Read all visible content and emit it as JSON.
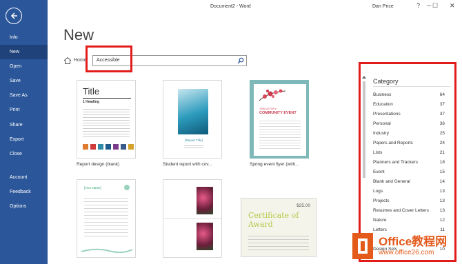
{
  "titlebar": {
    "doc_title": "Document2 - Word",
    "user": "Dan Price",
    "help": "?",
    "minimize": "─",
    "restore": "☐",
    "close": "✕"
  },
  "sidebar": {
    "items": [
      {
        "label": "Info"
      },
      {
        "label": "New"
      },
      {
        "label": "Open"
      },
      {
        "label": "Save"
      },
      {
        "label": "Save As"
      },
      {
        "label": "Print"
      },
      {
        "label": "Share"
      },
      {
        "label": "Export"
      },
      {
        "label": "Close"
      },
      {
        "label": "Account"
      },
      {
        "label": "Feedback"
      },
      {
        "label": "Options"
      }
    ]
  },
  "main": {
    "title": "New",
    "home_label": "Home",
    "search_value": "Accessible"
  },
  "templates": [
    {
      "label": "Report design (blank)",
      "thumb_title": "Title",
      "thumb_heading": "1   Heading"
    },
    {
      "label": "Student report with cov...",
      "thumb_title": "[Report Title]"
    },
    {
      "label": "Spring event flyer (with...",
      "thumb_title": "COMMUNITY EVENT",
      "thumb_sub": "JOIN US FOR A"
    },
    {
      "label": "",
      "thumb_title": "[Your Name]"
    },
    {
      "label": ""
    },
    {
      "label": "",
      "thumb_price": "$25.00",
      "thumb_title": "Certificate of Award"
    }
  ],
  "category": {
    "title": "Category",
    "items": [
      {
        "name": "Business",
        "count": "64"
      },
      {
        "name": "Education",
        "count": "37"
      },
      {
        "name": "Presentations",
        "count": "37"
      },
      {
        "name": "Personal",
        "count": "36"
      },
      {
        "name": "Industry",
        "count": "25"
      },
      {
        "name": "Papers and Reports",
        "count": "24"
      },
      {
        "name": "Lists",
        "count": "21"
      },
      {
        "name": "Planners and Trackers",
        "count": "18"
      },
      {
        "name": "Event",
        "count": "15"
      },
      {
        "name": "Blank and General",
        "count": "14"
      },
      {
        "name": "Logs",
        "count": "13"
      },
      {
        "name": "Projects",
        "count": "13"
      },
      {
        "name": "Resumes and Cover Letters",
        "count": "13"
      },
      {
        "name": "Nature",
        "count": "12"
      },
      {
        "name": "Letters",
        "count": "11"
      },
      {
        "name": "Design Sets",
        "count": "10"
      }
    ]
  },
  "watermark": {
    "brand": "Office教程网",
    "url": "www.office26.com"
  },
  "colors": {
    "sidebar": "#2b579a",
    "highlight": "#e21b1b",
    "accent": "#2b579a"
  }
}
